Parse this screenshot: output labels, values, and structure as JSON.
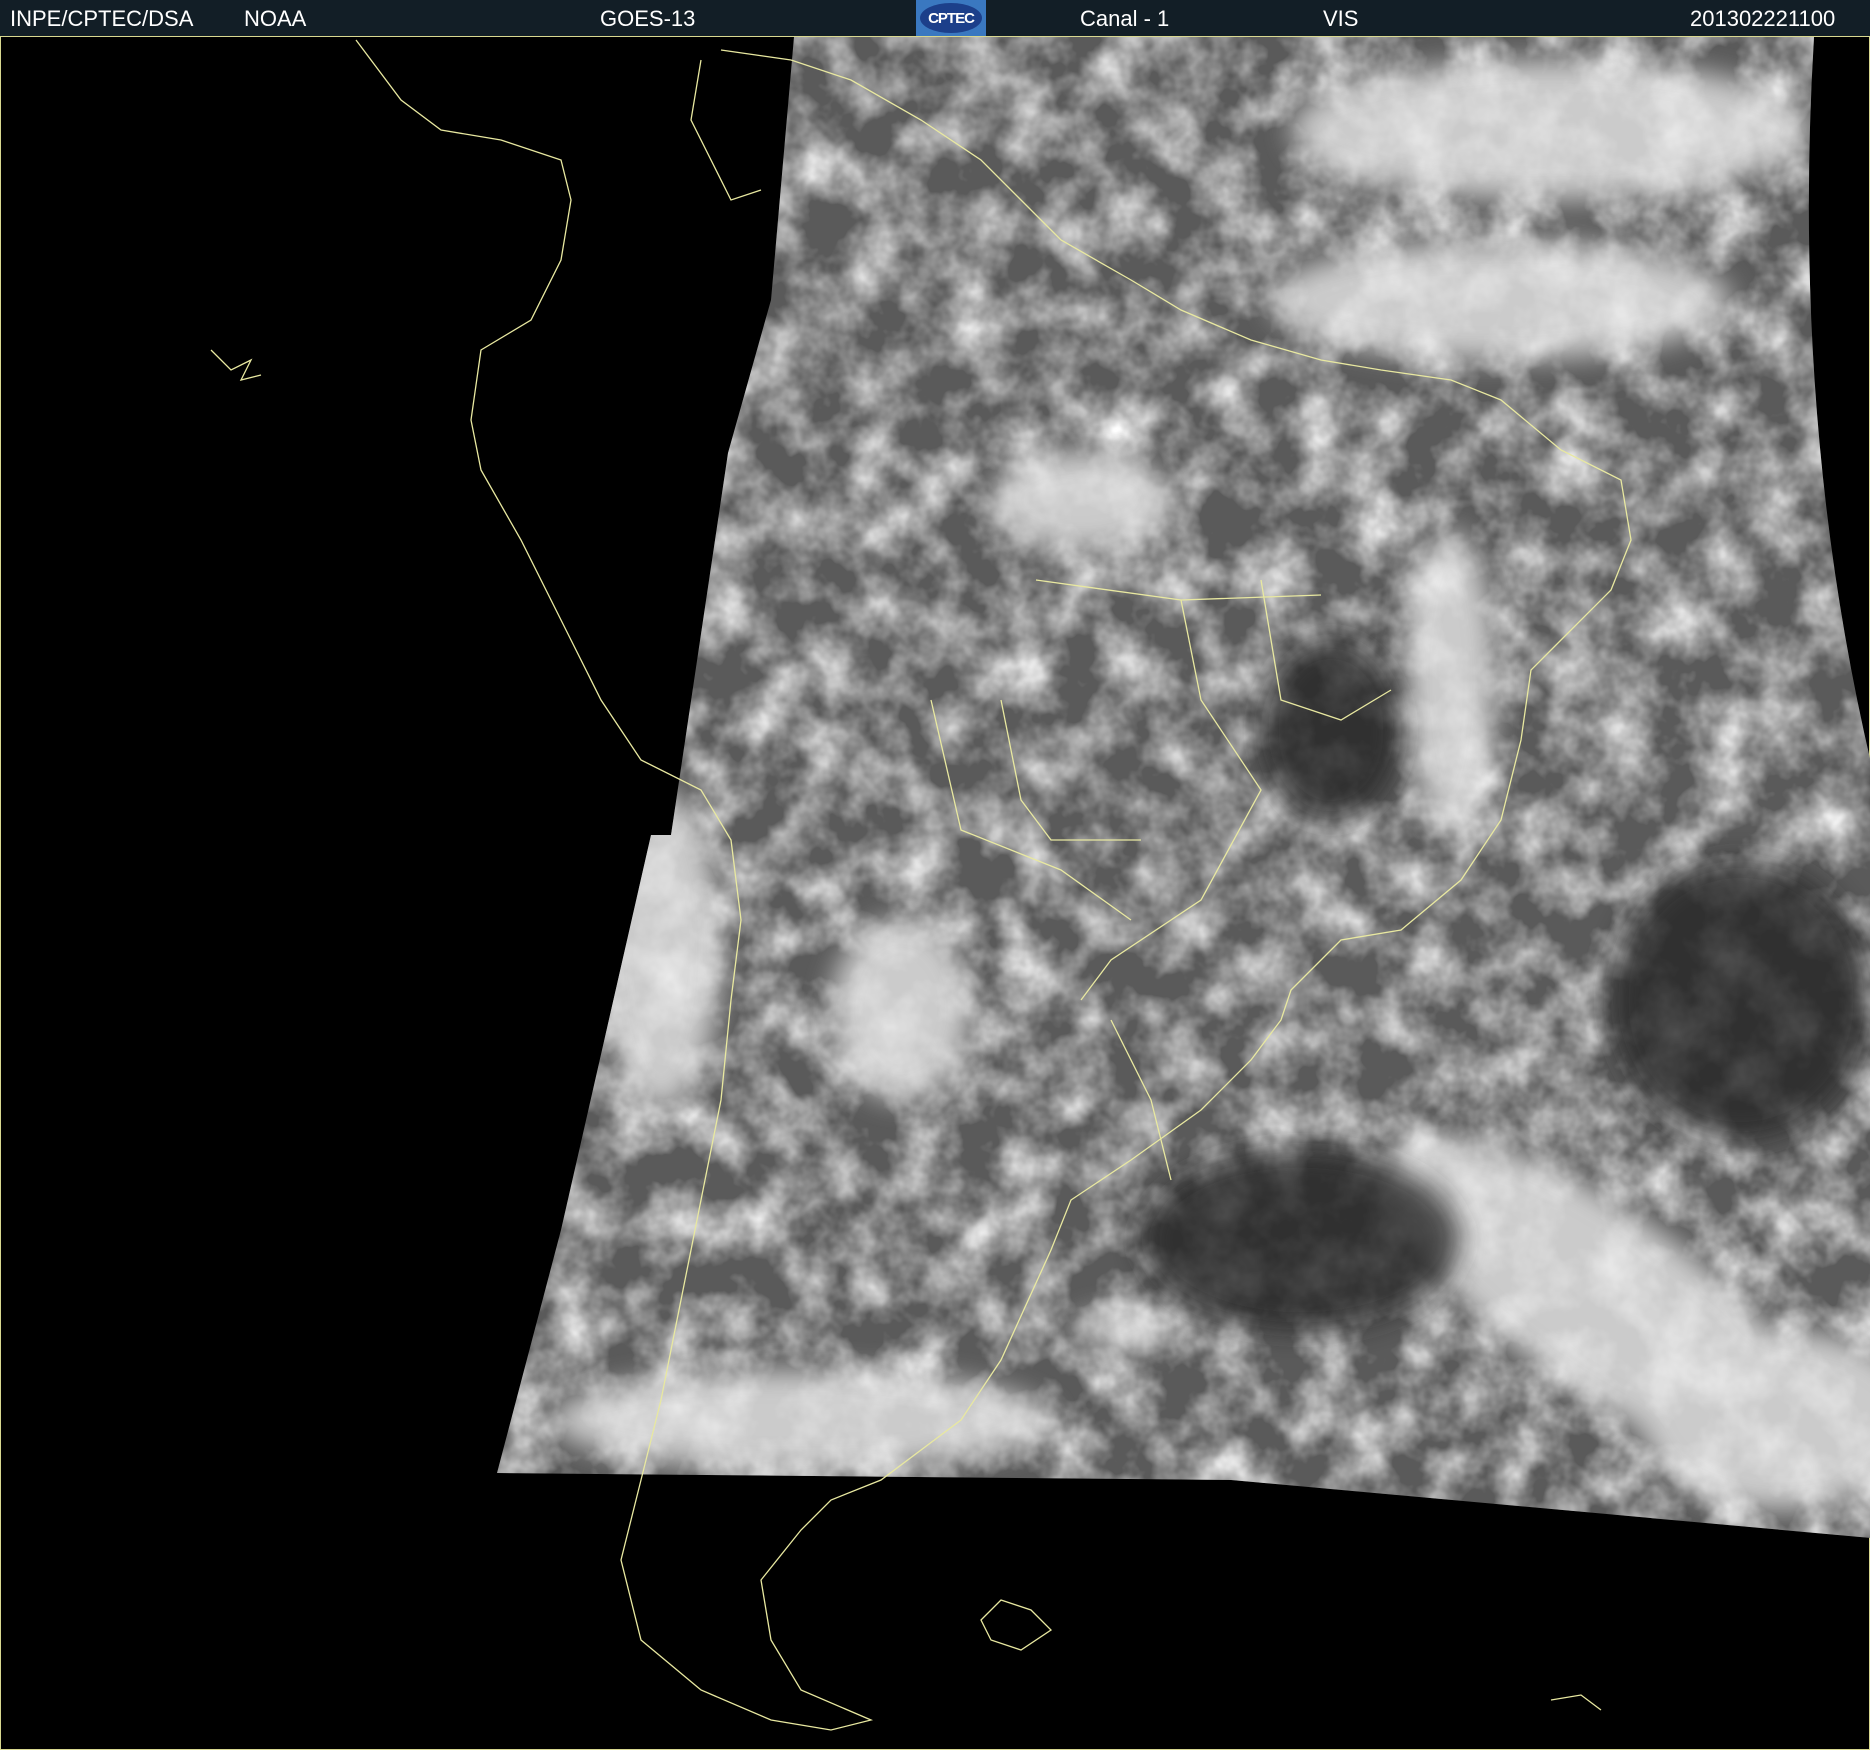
{
  "header": {
    "institution": "INPE/CPTEC/DSA",
    "agency": "NOAA",
    "satellite": "GOES-13",
    "logo_text": "CPTEC",
    "channel": "Canal - 1",
    "band": "VIS",
    "datetime": "201302221100"
  },
  "colors": {
    "header_bg": "#121e26",
    "coastline": "#e8e8a0",
    "logo_bg": "#3a78c0"
  }
}
